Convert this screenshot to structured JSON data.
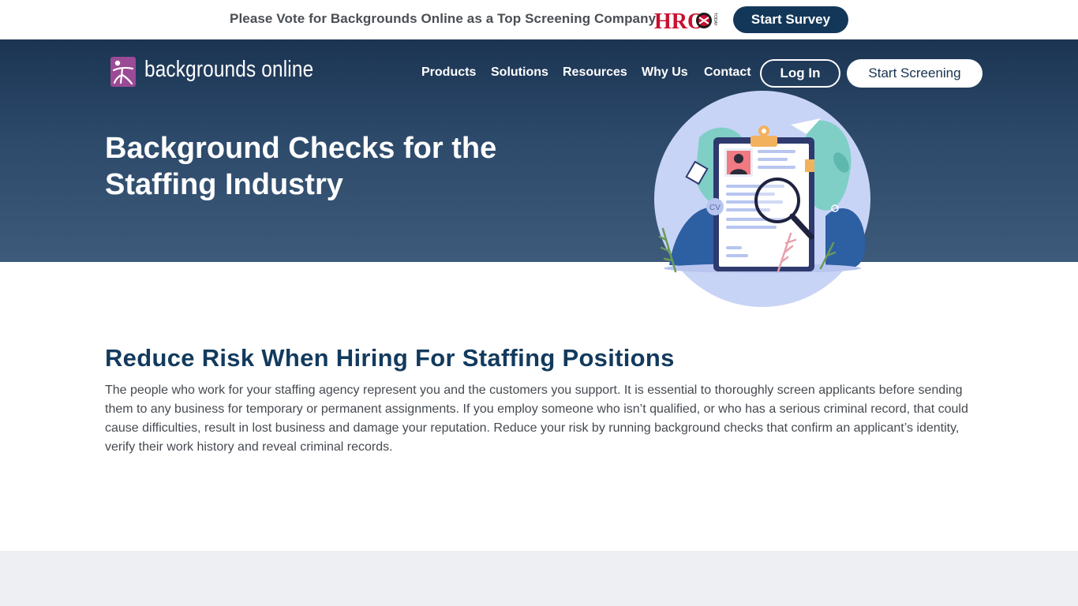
{
  "promo": {
    "text": "Please Vote for Backgrounds Online as a Top Screening Company",
    "logo_text": "HRO",
    "survey_button": "Start Survey"
  },
  "brand": {
    "name": "backgrounds online",
    "mark_color": "#9b4a96"
  },
  "nav": {
    "items": [
      {
        "label": "Products"
      },
      {
        "label": "Solutions"
      },
      {
        "label": "Resources"
      },
      {
        "label": "Why Us"
      },
      {
        "label": "Contact"
      }
    ],
    "login": "Log In",
    "start_screening": "Start Screening"
  },
  "hero": {
    "title_line1": "Background Checks for the",
    "title_line2": "Staffing Industry",
    "illustration": {
      "icon": "resume-magnifier-illustration",
      "cv_label": "CV"
    }
  },
  "section": {
    "title": "Reduce Risk When Hiring For Staffing Positions",
    "body": "The people who work for your staffing agency represent you and the customers you support. It is essential to thoroughly screen applicants before sending them to any business for temporary or permanent assignments. If you employ someone who isn’t qualified, or who has a serious criminal record, that could cause difficulties, result in lost business and damage your reputation. Reduce your risk by running background checks that confirm an applicant’s identity, verify their work history and reveal criminal records."
  },
  "colors": {
    "navy": "#133759",
    "heading": "#123a5e",
    "hero_top": "#1b3452",
    "hero_bottom": "#3d5a7a",
    "footer_band": "#eeeff3"
  }
}
